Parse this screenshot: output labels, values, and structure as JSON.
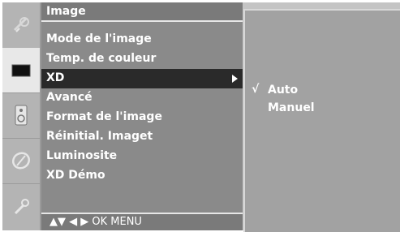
{
  "menu": {
    "title": "Image",
    "items": [
      {
        "label": "Mode de l'image"
      },
      {
        "label": "Temp. de couleur"
      },
      {
        "label": "XD"
      },
      {
        "label": "Avancé"
      },
      {
        "label": "Format de l'image"
      },
      {
        "label": "Réinitial. Imaget"
      },
      {
        "label": "Luminosite"
      },
      {
        "label": "XD Démo"
      }
    ],
    "selected_item": "XD",
    "footer": "▲▼  ◀ ▶  OK  MENU"
  },
  "submenu": {
    "items": [
      {
        "check": "√",
        "label": "Auto"
      },
      {
        "check": "",
        "label": "Manuel"
      }
    ]
  },
  "icons": [
    "satellite-dish-icon",
    "picture-screen-icon",
    "speaker-icon",
    "clock-icon",
    "wrench-icon"
  ],
  "colors": {
    "highlight": "#2a2a2a",
    "menu_bg": "#8a8a8a",
    "submenu_bg": "#a2a2a2"
  }
}
